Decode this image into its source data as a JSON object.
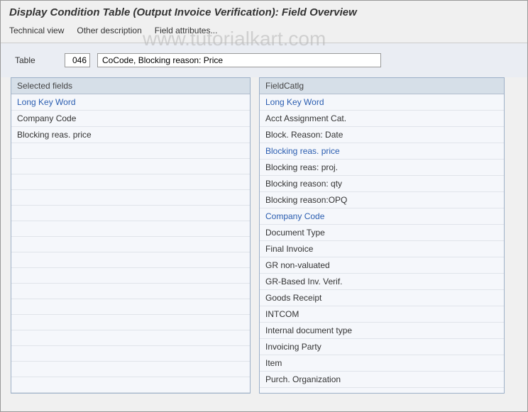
{
  "page_title": "Display Condition Table (Output Invoice Verification): Field Overview",
  "toolbar": {
    "technical_view": "Technical view",
    "other_description": "Other description",
    "field_attributes": "Field attributes..."
  },
  "form": {
    "table_label": "Table",
    "table_code": "046",
    "table_desc": "CoCode, Blocking reason: Price"
  },
  "selected_fields": {
    "header": "Selected fields",
    "column_header": "Long Key Word",
    "rows": [
      {
        "label": "Company Code",
        "link": false
      },
      {
        "label": "Blocking reas. price",
        "link": false
      }
    ]
  },
  "field_catalog": {
    "header": "FieldCatlg",
    "column_header": "Long Key Word",
    "rows": [
      {
        "label": "Acct Assignment Cat.",
        "link": false
      },
      {
        "label": "Block. Reason: Date",
        "link": false
      },
      {
        "label": "Blocking reas. price",
        "link": true
      },
      {
        "label": "Blocking reas: proj.",
        "link": false
      },
      {
        "label": "Blocking reason: qty",
        "link": false
      },
      {
        "label": "Blocking reason:OPQ",
        "link": false
      },
      {
        "label": "Company Code",
        "link": true
      },
      {
        "label": "Document Type",
        "link": false
      },
      {
        "label": "Final Invoice",
        "link": false
      },
      {
        "label": "GR non-valuated",
        "link": false
      },
      {
        "label": "GR-Based Inv. Verif.",
        "link": false
      },
      {
        "label": "Goods Receipt",
        "link": false
      },
      {
        "label": "INTCOM",
        "link": false
      },
      {
        "label": "Internal document type",
        "link": false
      },
      {
        "label": "Invoicing Party",
        "link": false
      },
      {
        "label": "Item",
        "link": false
      },
      {
        "label": "Purch. Organization",
        "link": false
      }
    ]
  },
  "watermark": "www.tutorialkart.com",
  "left_empty_rows": 16
}
